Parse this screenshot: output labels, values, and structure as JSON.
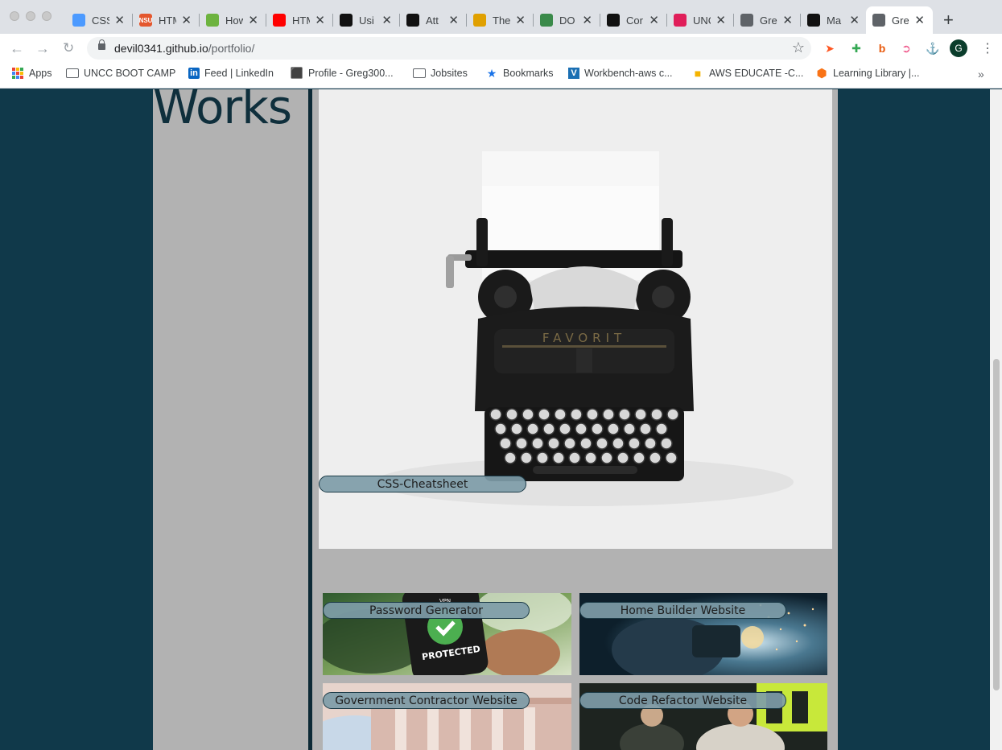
{
  "tabs": [
    {
      "label": "CSS",
      "favicon": "atlassian-icon",
      "color": "#4c9aff"
    },
    {
      "label": "HTML",
      "favicon": "nsu-icon",
      "color": "#e4572e",
      "fav_text": "NSU"
    },
    {
      "label": "How",
      "favicon": "leaf-icon",
      "color": "#6db33f"
    },
    {
      "label": "HTML",
      "favicon": "youtube-icon",
      "color": "#ff0000"
    },
    {
      "label": "Usi",
      "favicon": "bootcamp-icon",
      "color": "#111111"
    },
    {
      "label": "Att",
      "favicon": "bootcamp-icon",
      "color": "#111111"
    },
    {
      "label": "The",
      "favicon": "avatar-icon",
      "color": "#e0a000"
    },
    {
      "label": "DO",
      "favicon": "document-icon",
      "color": "#3a8a4a"
    },
    {
      "label": "Cor",
      "favicon": "ta-icon",
      "color": "#111111"
    },
    {
      "label": "UNC",
      "favicon": "slack-icon",
      "color": "#e01e5a"
    },
    {
      "label": "Gre",
      "favicon": "globe-icon",
      "color": "#5f6368"
    },
    {
      "label": "Ma",
      "favicon": "github-icon",
      "color": "#111111"
    },
    {
      "label": "Gre",
      "favicon": "globe-icon",
      "color": "#5f6368",
      "active": true
    }
  ],
  "address": {
    "host": "devil0341.github.io",
    "path": "/portfolio/"
  },
  "bookmarks": [
    {
      "label": "Apps",
      "icon": "apps-icon"
    },
    {
      "label": "UNCC BOOT CAMP",
      "icon": "folder-icon"
    },
    {
      "label": "Feed | LinkedIn",
      "icon": "linkedin-icon"
    },
    {
      "label": "Profile - Greg300...",
      "icon": "profile-icon"
    },
    {
      "label": "Jobsites",
      "icon": "folder-icon"
    },
    {
      "label": "Bookmarks",
      "icon": "star-icon"
    },
    {
      "label": "Workbench-aws c...",
      "icon": "vocareum-icon"
    },
    {
      "label": "AWS EDUCATE -C...",
      "icon": "aws-box-icon"
    },
    {
      "label": "Learning Library |...",
      "icon": "hexagon-icon"
    }
  ],
  "avatar_letter": "G",
  "page": {
    "section_heading": "Works",
    "hero_label": "CSS-Cheatsheet",
    "projects": [
      {
        "label": "Password Generator"
      },
      {
        "label": "Home Builder Website"
      },
      {
        "label": "Government Contractor Website"
      },
      {
        "label": "Code Refactor Website"
      }
    ],
    "typewriter_brand": "FAVORIT",
    "phone_badge_text": "PROTECTED",
    "phone_badge_top": "VPN",
    "colors": {
      "background": "#10394a",
      "panel": "#b2b2b2",
      "pill": "#7e9ca8",
      "heading": "#0f2f3c"
    }
  }
}
